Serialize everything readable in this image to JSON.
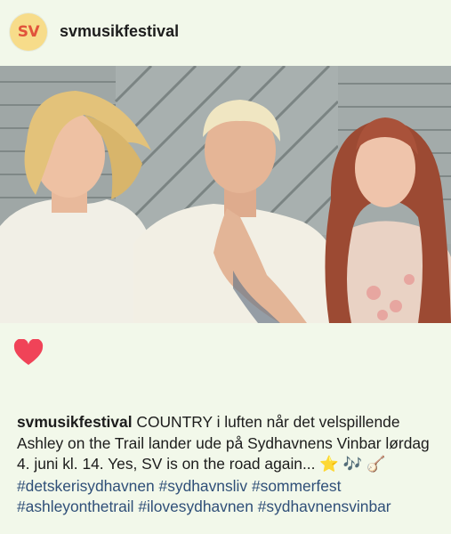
{
  "post": {
    "username": "svmusikfestival",
    "avatar_text": "SV"
  },
  "actions": {
    "like_icon": "heart-icon",
    "like_color": "#f04358"
  },
  "caption": {
    "username": "svmusikfestival",
    "text": "COUNTRY i luften når det velspillende Ashley on the Trail lander ude på Sydhavnens Vinbar lørdag 4. juni kl. 14. Yes, SV is on the road again...",
    "emojis": {
      "star": "⭐",
      "notes": "🎶",
      "banjo": "🪕"
    },
    "hashtags": [
      "#detskerisydhavnen",
      "#sydhavnsliv",
      "#sommerfest",
      "#ashleyonthetrail",
      "#ilovesydhavnen",
      "#sydhavnensvinbar"
    ]
  },
  "colors": {
    "background": "#f2f8ea",
    "hashtag": "#2f4f78",
    "avatar_bg": "#f7dc8a",
    "avatar_text": "#e1533b"
  }
}
